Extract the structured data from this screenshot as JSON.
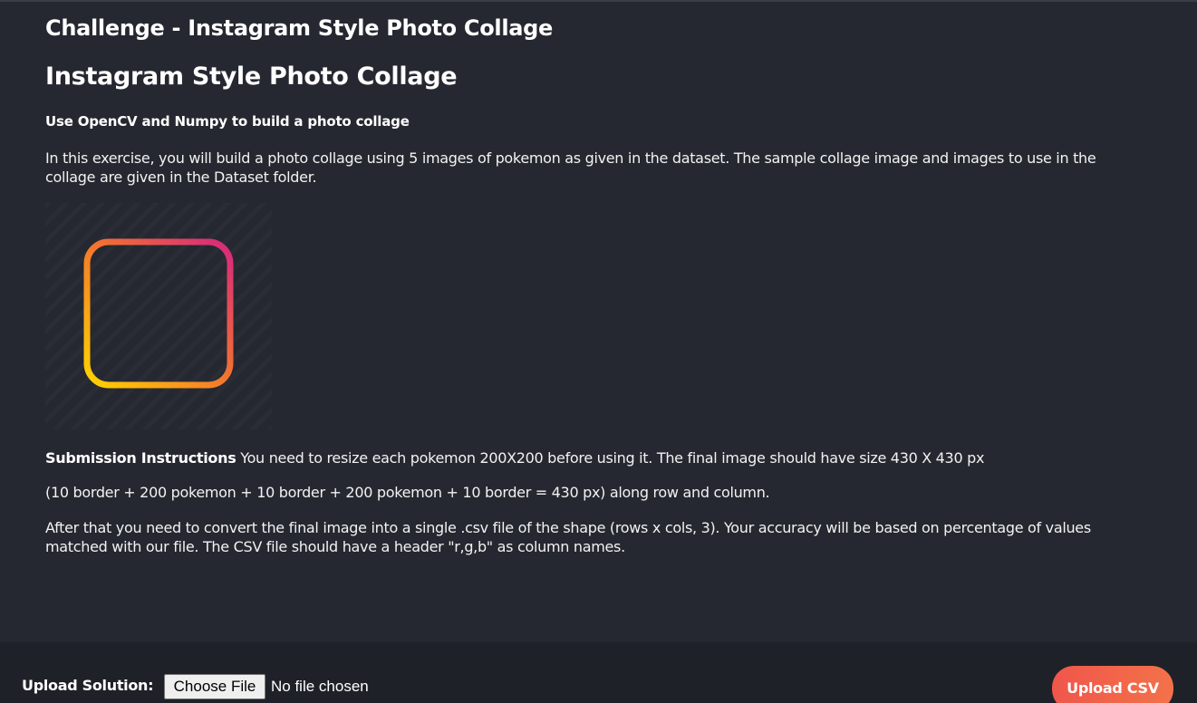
{
  "challenge": {
    "title": "Challenge - Instagram Style Photo Collage"
  },
  "description": {
    "heading": "Instagram Style Photo Collage",
    "subheading": "Use OpenCV and Numpy to build a photo collage",
    "intro": "In this exercise, you will build a photo collage using 5 images of pokemon as given in the dataset. The sample collage image and images to use in the collage are given in the Dataset folder.",
    "image_icon": "instagram-layout-icon",
    "gradient_colors": [
      "#ffd400",
      "#f4772c",
      "#d6277f"
    ]
  },
  "submission": {
    "label": "Submission Instructions",
    "line1": " You need to resize each pokemon 200X200 before using it. The final image should have size 430 X 430 px",
    "line2": "(10 border + 200 pokemon + 10 border + 200 pokemon + 10 border = 430 px) along row and column.",
    "line3": "After that you need to convert the final image into a single .csv file of the shape (rows x cols, 3). Your accuracy will be based on percentage of values matched with our file. The CSV file should have a header \"r,g,b\" as column names."
  },
  "upload": {
    "label": "Upload Solution:",
    "choose_file": "Choose File",
    "file_status": "No file chosen",
    "button": "Upload CSV",
    "accent": "#f0564b"
  }
}
